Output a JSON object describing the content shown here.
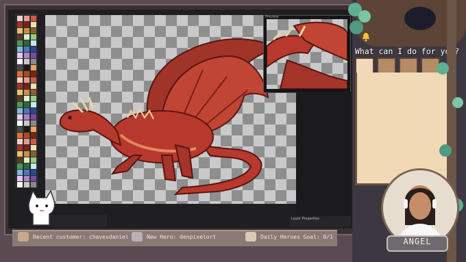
{
  "editor": {
    "preview_title": "Preview",
    "layer_properties_label": "Layer Properties"
  },
  "status": {
    "recent_customer": "Recent customer: chavesdaniel",
    "new_hero": "New Hero: denpixelort",
    "goal": "Daily Heroes Goal: 0/1"
  },
  "sidebar": {
    "prompt": "What can I do for you?",
    "tabs": [
      {
        "name": "hand-icon"
      },
      {
        "name": "drink-icon"
      },
      {
        "name": "gear-wheel-icon"
      },
      {
        "name": "potion-icon"
      }
    ]
  },
  "streamer": {
    "name": "ANGEL"
  },
  "colors": {
    "accent": "#8a7a76",
    "dragon_red": "#b7382c",
    "parchment": "#f1d9b6"
  }
}
